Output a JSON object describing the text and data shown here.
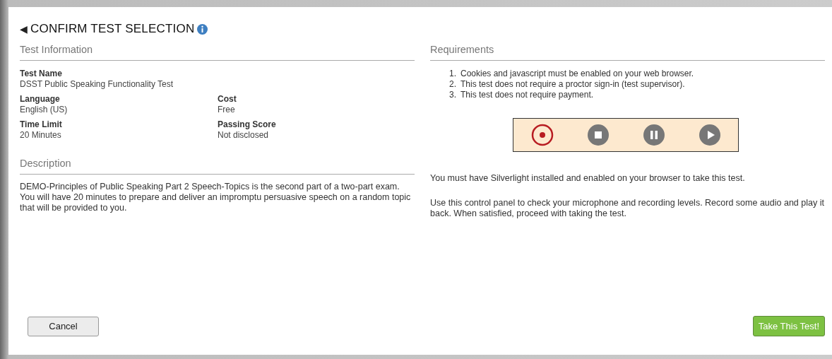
{
  "header": {
    "back_glyph": "◀",
    "title": "CONFIRM TEST SELECTION"
  },
  "test_information": {
    "heading": "Test Information",
    "test_name": {
      "label": "Test Name",
      "value": "DSST Public Speaking Functionality Test"
    },
    "fields": [
      {
        "label": "Language",
        "value": "English (US)"
      },
      {
        "label": "Cost",
        "value": "Free"
      },
      {
        "label": "Time Limit",
        "value": "20 Minutes"
      },
      {
        "label": "Passing Score",
        "value": "Not disclosed"
      }
    ]
  },
  "description": {
    "heading": "Description",
    "text": "DEMO-Principles of Public Speaking Part 2 Speech-Topics is the second part of a two-part exam. You will have 20 minutes to prepare and deliver an impromptu persuasive speech on a random topic that will be provided to you."
  },
  "requirements": {
    "heading": "Requirements",
    "items": [
      {
        "number": "1.",
        "text": "Cookies and javascript must be enabled on your web browser."
      },
      {
        "number": "2.",
        "text": "This test does not require a proctor sign-in (test supervisor)."
      },
      {
        "number": "3.",
        "text": "This test does not require payment."
      }
    ],
    "recorder_controls": [
      {
        "kind": "record",
        "selected": true
      },
      {
        "kind": "stop",
        "selected": false
      },
      {
        "kind": "pause",
        "selected": false
      },
      {
        "kind": "play",
        "selected": false
      }
    ],
    "notes": [
      "You must have Silverlight installed and enabled on your browser to take this test.",
      "Use this control panel to check your microphone and recording levels. Record some audio and play it back. When satisfied, proceed with taking the test."
    ]
  },
  "buttons": {
    "cancel": "Cancel",
    "take_test": "Take This Test!"
  }
}
